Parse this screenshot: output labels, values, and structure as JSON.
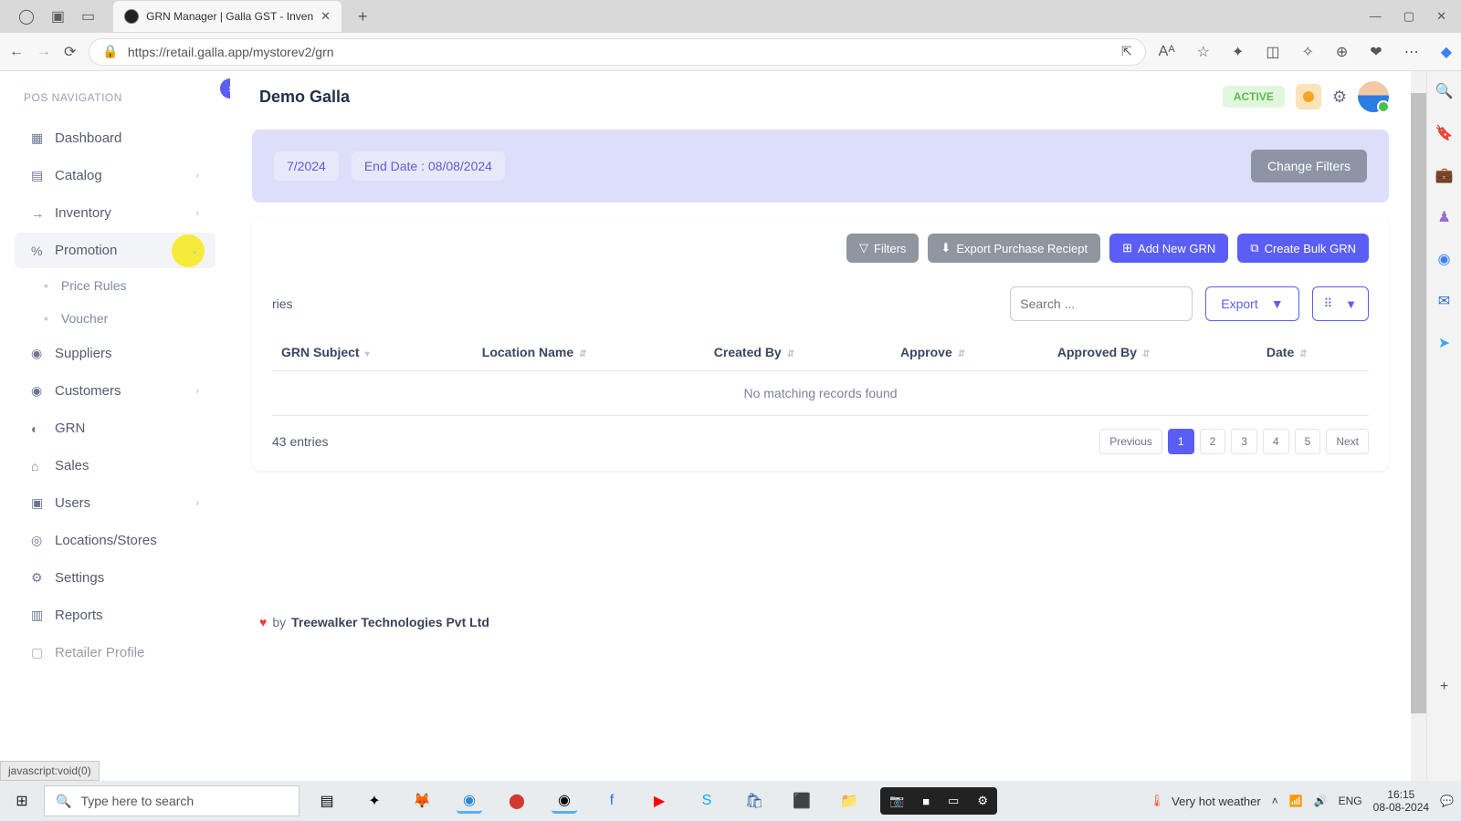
{
  "browser": {
    "tab_title": "GRN Manager | Galla GST - Inven",
    "url": "https://retail.galla.app/mystorev2/grn",
    "status_link": "javascript:void(0)"
  },
  "sidebar": {
    "heading": "POS NAVIGATION",
    "items": {
      "dashboard": "Dashboard",
      "catalog": "Catalog",
      "inventory": "Inventory",
      "promotion": "Promotion",
      "priceRules": "Price Rules",
      "voucher": "Voucher",
      "suppliers": "Suppliers",
      "customers": "Customers",
      "grn": "GRN",
      "sales": "Sales",
      "users": "Users",
      "locations": "Locations/Stores",
      "settings": "Settings",
      "reports": "Reports",
      "retailer": "Retailer Profile"
    }
  },
  "header": {
    "title": "Demo Galla",
    "status": "ACTIVE"
  },
  "filters": {
    "start": "7/2024",
    "end": "End Date : 08/08/2024",
    "change": "Change Filters"
  },
  "toolbar": {
    "filters": "Filters",
    "export_receipt": "Export Purchase Reciept",
    "add_grn": "Add New GRN",
    "bulk_grn": "Create Bulk GRN"
  },
  "table": {
    "entries_label": "ries",
    "search_placeholder": "Search ...",
    "export": "Export",
    "columns": {
      "subject": "GRN Subject",
      "location": "Location Name",
      "createdBy": "Created By",
      "approve": "Approve",
      "approvedBy": "Approved By",
      "date": "Date"
    },
    "no_records": "No matching records found",
    "count": "43 entries",
    "pager": {
      "prev": "Previous",
      "p1": "1",
      "p2": "2",
      "p3": "3",
      "p4": "4",
      "p5": "5",
      "next": "Next"
    }
  },
  "footer": {
    "by": " by ",
    "company": "Treewalker Technologies Pvt Ltd"
  },
  "taskbar": {
    "search_placeholder": "Type here to search",
    "weather": "Very hot weather",
    "lang": "ENG",
    "time": "16:15",
    "date": "08-08-2024"
  }
}
